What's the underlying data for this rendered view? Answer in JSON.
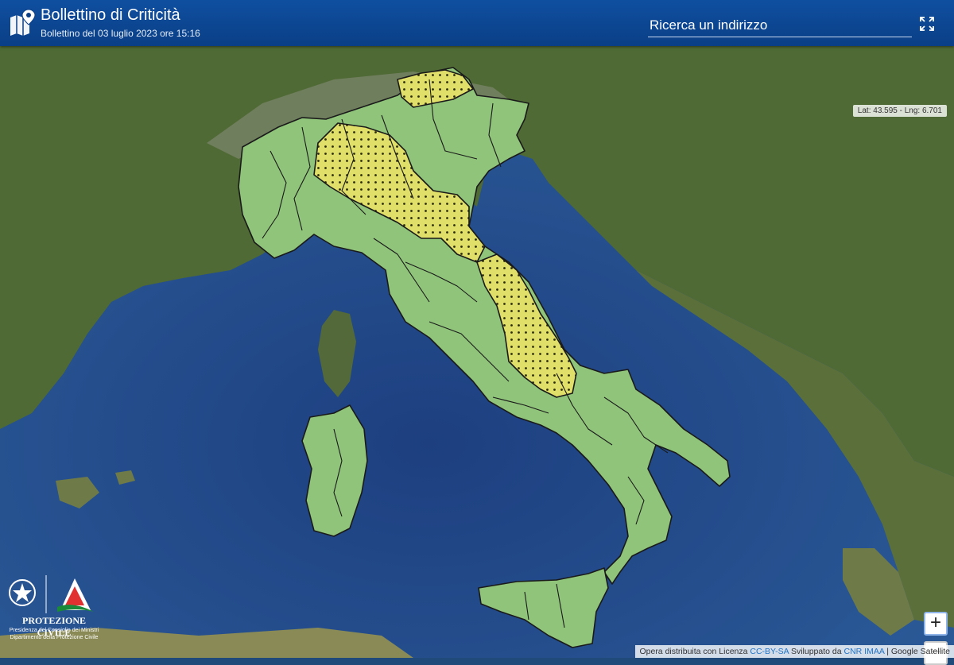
{
  "header": {
    "title": "Bollettino di Criticità",
    "subtitle": "Bollettino del 03 luglio 2023 ore 15:16"
  },
  "search": {
    "placeholder": "Ricerca un indirizzo"
  },
  "icons": {
    "app": "map-icon",
    "fullscreen": "fullscreen-icon",
    "emblem": "republic-emblem-icon",
    "civil_protection": "civil-protection-logo-icon"
  },
  "map": {
    "coords": "Lat: 43.595 - Lng: 6.701",
    "zoom_in": "+",
    "zoom_out": "−"
  },
  "logo": {
    "title": "PROTEZIONE CIVILE",
    "line1": "Presidenza del Consiglio dei Ministri",
    "line2": "Dipartimento della Protezione Civile"
  },
  "attribution": {
    "text1": "Opera distribuita con Licenza",
    "license": "CC-BY-SA",
    "text2": "Sviluppato da",
    "developer": "CNR IMAA",
    "sep": "|",
    "provider": "Google Satellite"
  },
  "colors": {
    "header": "#0a3f86",
    "alert_green": "#8fc47a",
    "alert_yellow": "#e0df6a",
    "sea": "#24528f",
    "land": "#4f6a34"
  }
}
